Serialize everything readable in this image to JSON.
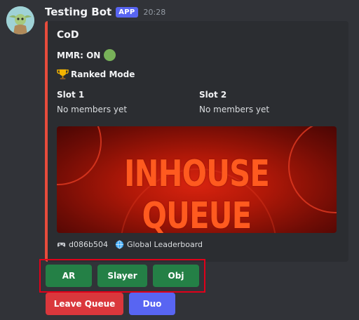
{
  "message": {
    "username": "Testing Bot",
    "badge": "APP",
    "timestamp": "20:28",
    "avatar_icon": "baby-yoda-avatar"
  },
  "embed": {
    "accent_color": "#e74c3c",
    "title": "CoD",
    "mmr_label": "MMR: ON",
    "mmr_status_icon": "green-circle-icon",
    "mode_icon": "trophy-icon",
    "mode_label": "Ranked Mode",
    "slots": [
      {
        "name": "Slot 1",
        "value": "No members yet"
      },
      {
        "name": "Slot 2",
        "value": "No members yet"
      }
    ],
    "banner_text": "INHOUSE QUEUE",
    "footer": {
      "id_icon": "gamepad-icon",
      "id_text": "d086b504",
      "link_icon": "globe-icon",
      "link_text": "Global Leaderboard"
    }
  },
  "buttons": {
    "row1": [
      {
        "label": "AR",
        "color": "#248046"
      },
      {
        "label": "Slayer",
        "color": "#248046"
      },
      {
        "label": "Obj",
        "color": "#248046"
      }
    ],
    "row2": [
      {
        "label": "Leave Queue",
        "color": "#da373c"
      },
      {
        "label": "Duo",
        "color": "#5865f2"
      }
    ]
  }
}
